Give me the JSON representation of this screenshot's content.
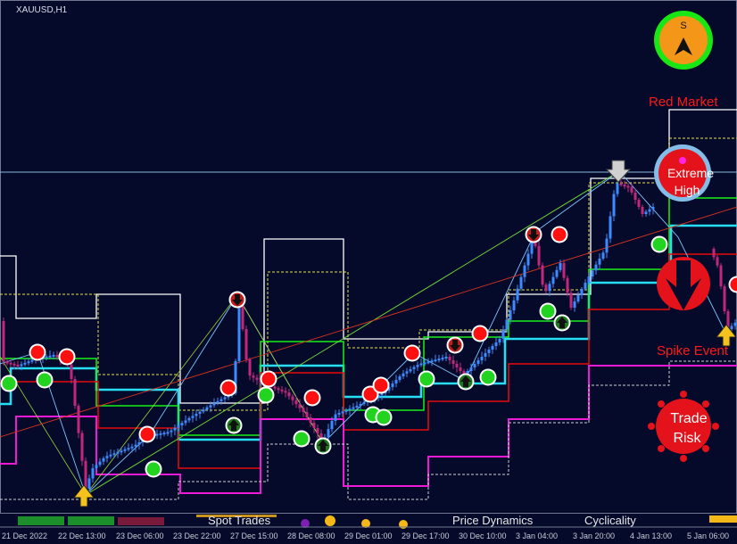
{
  "symbol_label": "XAUUSD,H1",
  "badges": {
    "compass_letter": "S",
    "red_market": "Red Market",
    "extreme_line1": "Extreme",
    "extreme_line2": "High",
    "spike_event": "Spike Event",
    "trade_line1": "Trade",
    "trade_line2": "Risk"
  },
  "bottom_panel": {
    "spot_trades": "Spot Trades",
    "price_dynamics": "Price Dynamics",
    "cyclicality": "Cyclicality"
  },
  "time_axis": [
    "21 Dec 2022",
    "22 Dec 13:00",
    "23 Dec 06:00",
    "23 Dec 22:00",
    "27 Dec 15:00",
    "28 Dec 08:00",
    "29 Dec 01:00",
    "29 Dec 17:00",
    "30 Dec 10:00",
    "3 Jan 04:00",
    "3 Jan 20:00",
    "4 Jan 13:00",
    "5 Jan 06:00"
  ],
  "colors": {
    "background": "#050a2a",
    "bull_candle": "#3d8bff",
    "bear_candle": "#c0287d",
    "sell_marker": "#ff1010",
    "buy_marker": "#22d41f",
    "band_white": "#ffffff",
    "band_cyan": "#27dff4",
    "band_green": "#16f216",
    "band_red": "#e80a0a",
    "band_magenta": "#ef1ad8",
    "compass_orange": "#f49618",
    "compass_green": "#19e615",
    "extreme_ring": "#84bde8",
    "label_red": "#ff1818"
  }
}
